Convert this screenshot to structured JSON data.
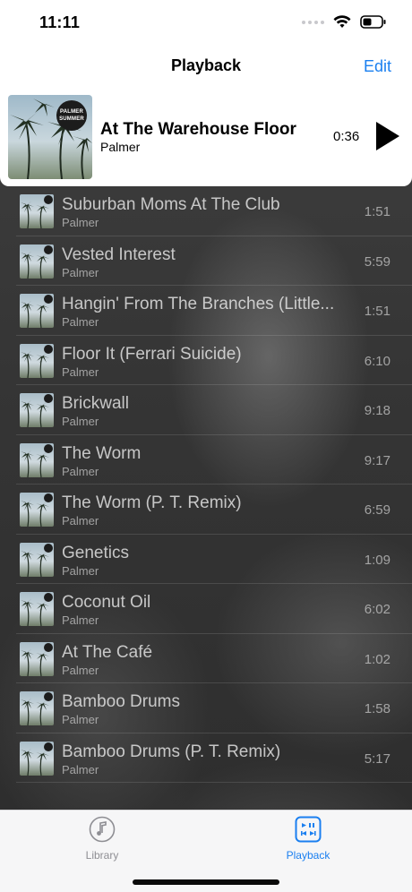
{
  "status_bar": {
    "time": "11:11"
  },
  "nav": {
    "title": "Playback",
    "edit_label": "Edit"
  },
  "now_playing": {
    "title": "At The Warehouse Floor",
    "artist": "Palmer",
    "elapsed": "0:36",
    "art_badge": "PALMER SUMMER"
  },
  "tracks": [
    {
      "title": "Suburban Moms At The Club",
      "artist": "Palmer",
      "duration": "1:51"
    },
    {
      "title": "Vested Interest",
      "artist": "Palmer",
      "duration": "5:59"
    },
    {
      "title": "Hangin' From The Branches (Little...",
      "artist": "Palmer",
      "duration": "1:51"
    },
    {
      "title": "Floor It (Ferrari Suicide)",
      "artist": "Palmer",
      "duration": "6:10"
    },
    {
      "title": "Brickwall",
      "artist": "Palmer",
      "duration": "9:18"
    },
    {
      "title": "The Worm",
      "artist": "Palmer",
      "duration": "9:17"
    },
    {
      "title": "The Worm (P. T. Remix)",
      "artist": "Palmer",
      "duration": "6:59"
    },
    {
      "title": "Genetics",
      "artist": "Palmer",
      "duration": "1:09"
    },
    {
      "title": "Coconut Oil",
      "artist": "Palmer",
      "duration": "6:02"
    },
    {
      "title": "At The Café",
      "artist": "Palmer",
      "duration": "1:02"
    },
    {
      "title": "Bamboo Drums",
      "artist": "Palmer",
      "duration": "1:58"
    },
    {
      "title": "Bamboo Drums (P. T. Remix)",
      "artist": "Palmer",
      "duration": "5:17"
    }
  ],
  "tabs": [
    {
      "label": "Library",
      "icon": "music-note-icon"
    },
    {
      "label": "Playback",
      "icon": "playback-icon"
    }
  ],
  "colors": {
    "accent": "#1a7ff0",
    "tab_inactive": "#8e8e93"
  }
}
